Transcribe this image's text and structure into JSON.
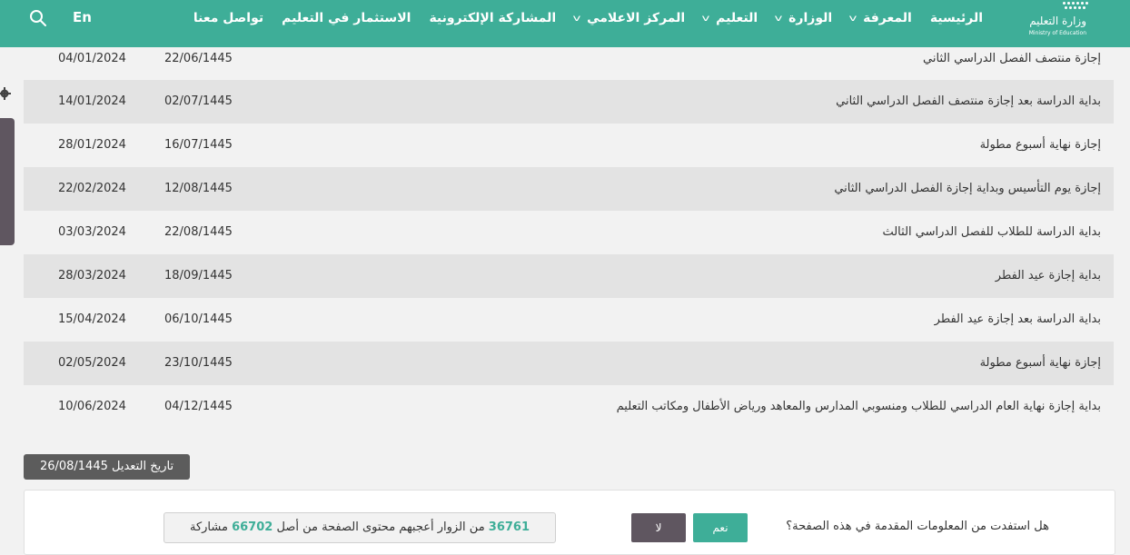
{
  "header": {
    "logo": {
      "arabic": "وزارة التعليم",
      "english": "Ministry of Education"
    },
    "nav": [
      {
        "label": "الرئيسية",
        "dropdown": false
      },
      {
        "label": "المعرفة",
        "dropdown": true
      },
      {
        "label": "الوزارة",
        "dropdown": true
      },
      {
        "label": "التعليم",
        "dropdown": true
      },
      {
        "label": "المركز الاعلامي",
        "dropdown": true
      },
      {
        "label": "المشاركة الإلكترونية",
        "dropdown": false
      },
      {
        "label": "الاستثمار في التعليم",
        "dropdown": false
      },
      {
        "label": "تواصل معنا",
        "dropdown": false
      }
    ],
    "lang": "En",
    "search_icon": "search-icon",
    "color": "#3eae98"
  },
  "table": {
    "rows": [
      {
        "event": "إجازة منتصف الفصل الدراسي الثاني",
        "hijri": "22/06/1445",
        "gregorian": "04/01/2024"
      },
      {
        "event": "بداية الدراسة بعد إجازة منتصف الفصل الدراسي الثاني",
        "hijri": "02/07/1445",
        "gregorian": "14/01/2024"
      },
      {
        "event": "إجازة نهاية أسبوع مطولة",
        "hijri": "16/07/1445",
        "gregorian": "28/01/2024"
      },
      {
        "event": "إجازة يوم التأسيس وبداية إجازة الفصل الدراسي الثاني",
        "hijri": "12/08/1445",
        "gregorian": "22/02/2024"
      },
      {
        "event": "بداية الدراسة للطلاب للفصل الدراسي الثالث",
        "hijri": "22/08/1445",
        "gregorian": "03/03/2024"
      },
      {
        "event": "بداية إجازة عيد الفطر",
        "hijri": "18/09/1445",
        "gregorian": "28/03/2024"
      },
      {
        "event": "بداية الدراسة بعد إجازة عيد الفطر",
        "hijri": "06/10/1445",
        "gregorian": "15/04/2024"
      },
      {
        "event": "إجازة نهاية أسبوع مطولة",
        "hijri": "23/10/1445",
        "gregorian": "02/05/2024"
      },
      {
        "event": "بداية إجازة نهاية العام الدراسي للطلاب ومنسوبي المدارس والمعاهد ورياض الأطفال ومكاتب التعليم",
        "hijri": "04/12/1445",
        "gregorian": "10/06/2024"
      }
    ]
  },
  "modified": {
    "text": "تاريخ التعديل 26/08/1445"
  },
  "feedback": {
    "question": "هل استفدت من المعلومات المقدمة في هذه الصفحة؟",
    "yes_label": "نعم",
    "no_label": "لا",
    "stats": {
      "liked": "36761",
      "middle": "من الزوار أعجبهم محتوى الصفحة من أصل",
      "total": "66702",
      "suffix": "مشاركة"
    }
  },
  "side": {
    "gear_icon": "gear-icon",
    "color": "#5f5660"
  }
}
